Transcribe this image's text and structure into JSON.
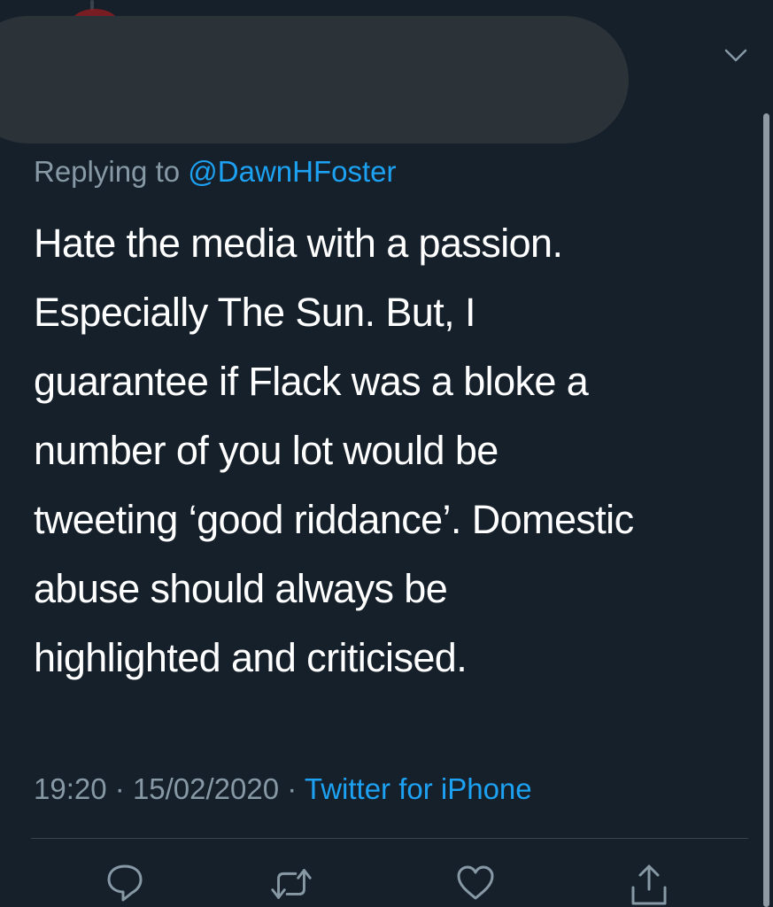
{
  "reply": {
    "prefix": "Replying to",
    "handle": "@DawnHFoster"
  },
  "tweet": {
    "text": "Hate the media with a passion.\nEspecially The Sun. But, I\nguarantee if Flack was a bloke a\nnumber of you lot would be\ntweeting ‘good riddance’. Domestic\nabuse should always be\nhighlighted and criticised."
  },
  "meta": {
    "time": "19:20",
    "separator": "·",
    "date": "15/02/2020",
    "source": "Twitter for iPhone"
  },
  "icons": {
    "header_menu": "chevron-down-icon",
    "reply": "reply-icon",
    "retweet": "retweet-icon",
    "like": "heart-icon",
    "share": "share-icon"
  },
  "colors": {
    "background": "#15202b",
    "text": "#ffffff",
    "secondary": "#8899a6",
    "accent": "#1da1f2",
    "divider": "#38444d"
  }
}
